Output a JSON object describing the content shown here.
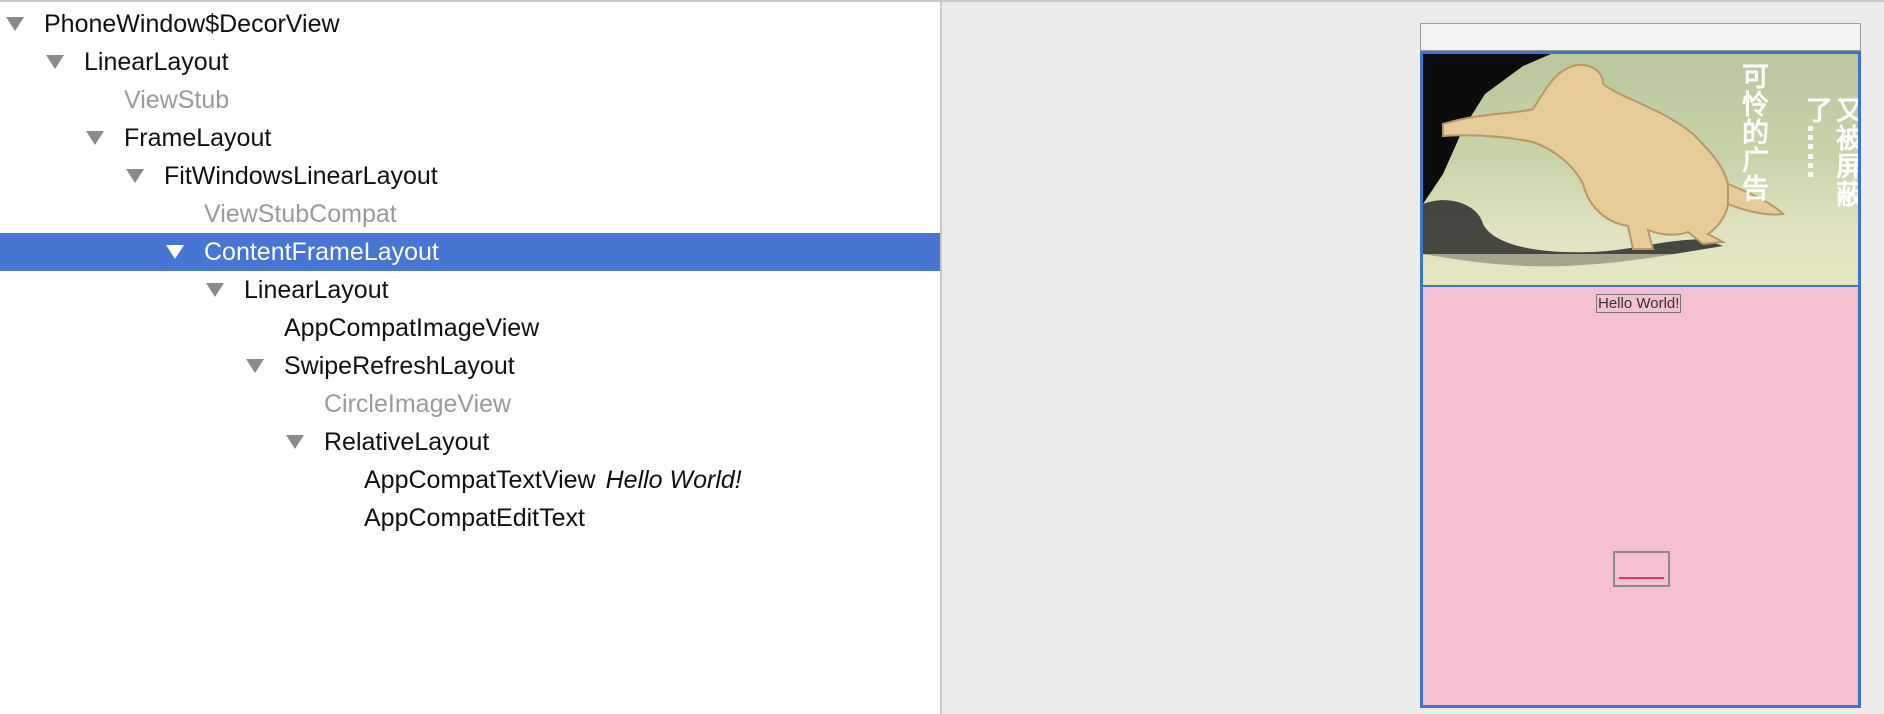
{
  "tree": {
    "nodes": [
      {
        "name": "PhoneWindow$DecorView",
        "detail": "",
        "expanded": true,
        "dim": false,
        "selected": false
      },
      {
        "name": "LinearLayout",
        "detail": "",
        "expanded": true,
        "dim": false,
        "selected": false
      },
      {
        "name": "ViewStub",
        "detail": "",
        "expanded": false,
        "dim": true,
        "selected": false
      },
      {
        "name": "FrameLayout",
        "detail": "",
        "expanded": true,
        "dim": false,
        "selected": false
      },
      {
        "name": "FitWindowsLinearLayout",
        "detail": "",
        "expanded": true,
        "dim": false,
        "selected": false
      },
      {
        "name": "ViewStubCompat",
        "detail": "",
        "expanded": false,
        "dim": true,
        "selected": false
      },
      {
        "name": "ContentFrameLayout",
        "detail": "",
        "expanded": true,
        "dim": false,
        "selected": true
      },
      {
        "name": "LinearLayout",
        "detail": "",
        "expanded": true,
        "dim": false,
        "selected": false
      },
      {
        "name": "AppCompatImageView",
        "detail": "",
        "expanded": false,
        "dim": false,
        "selected": false
      },
      {
        "name": "SwipeRefreshLayout",
        "detail": "",
        "expanded": true,
        "dim": false,
        "selected": false
      },
      {
        "name": "CircleImageView",
        "detail": "",
        "expanded": false,
        "dim": true,
        "selected": false
      },
      {
        "name": "RelativeLayout",
        "detail": "",
        "expanded": true,
        "dim": false,
        "selected": false
      },
      {
        "name": "AppCompatTextView",
        "detail": "Hello World!",
        "expanded": false,
        "dim": false,
        "selected": false
      },
      {
        "name": "AppCompatEditText",
        "detail": "",
        "expanded": false,
        "dim": false,
        "selected": false
      }
    ]
  },
  "preview": {
    "ad_text_line1": "可怜的广告",
    "ad_text_line2": "又被屏蔽了……",
    "hello_text": "Hello World!"
  },
  "colors": {
    "selection": "#4675d4",
    "screen_background": "#f5c0d2",
    "device_border": "#3c76c8",
    "edit_underline": "#e0336e"
  }
}
